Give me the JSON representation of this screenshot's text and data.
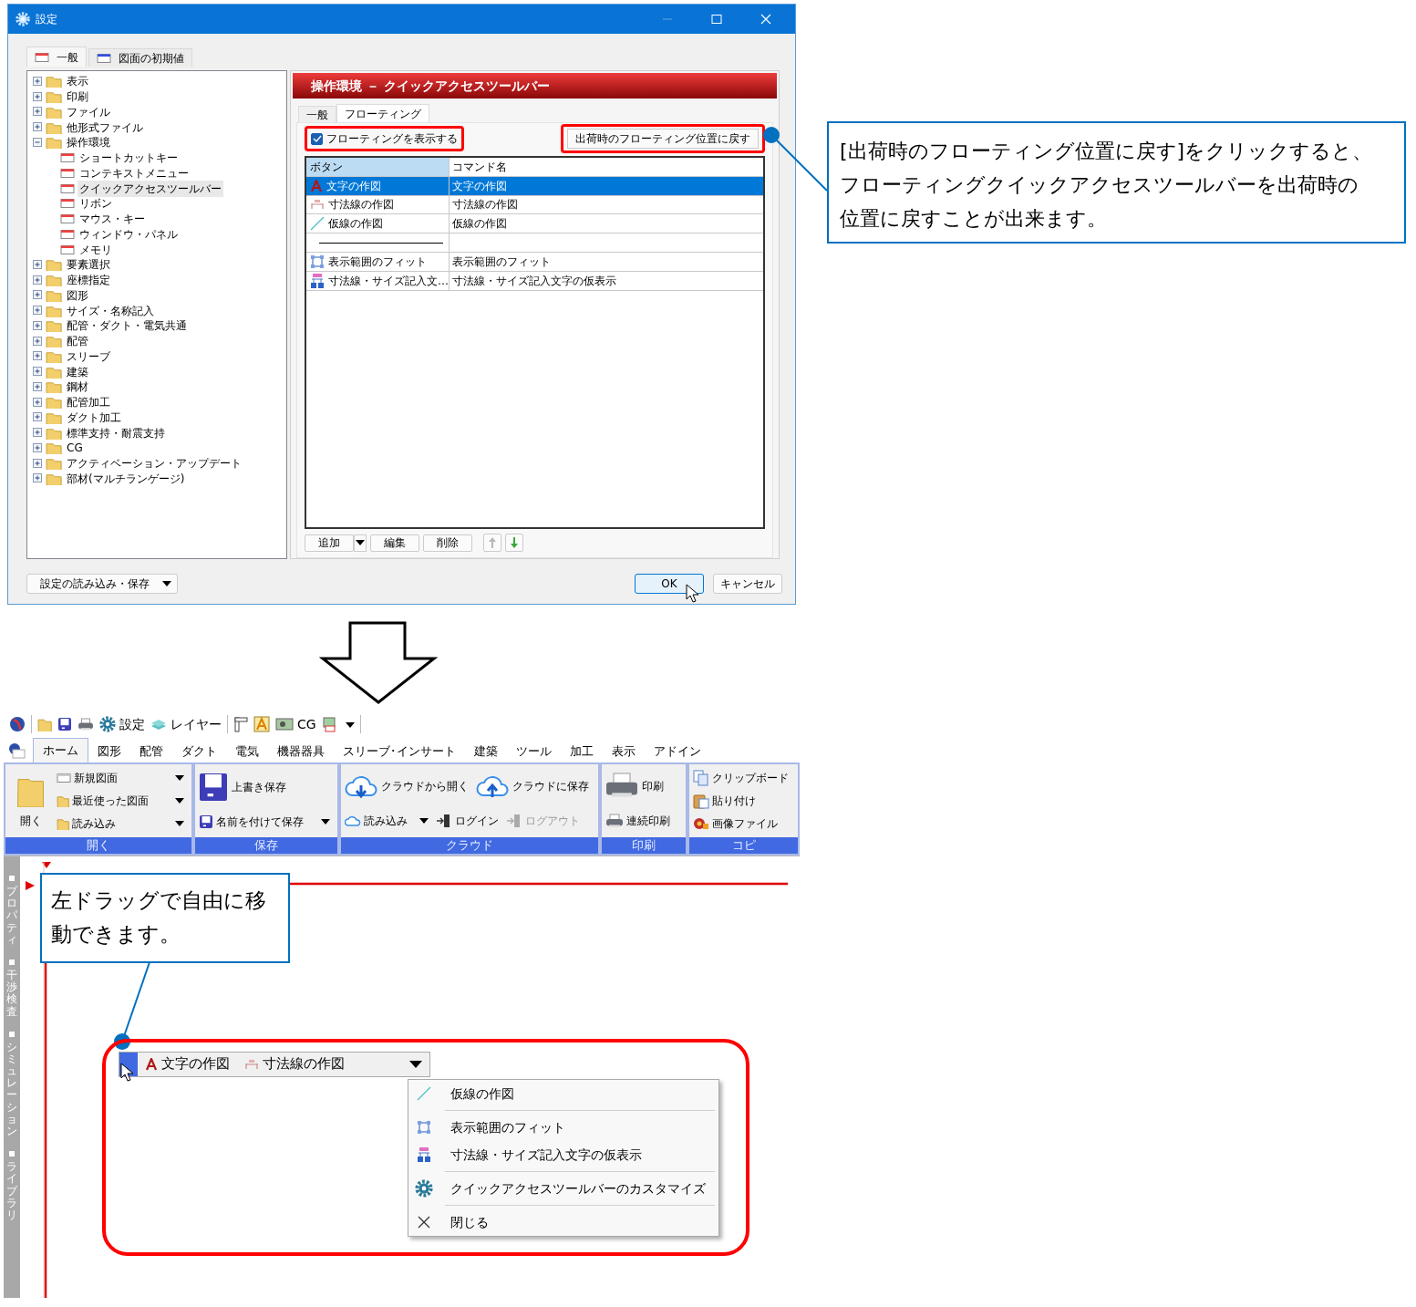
{
  "dialog": {
    "title": "設定",
    "tabs": [
      {
        "label": "一般",
        "selected": true
      },
      {
        "label": "図面の初期値",
        "selected": false
      }
    ],
    "tree": [
      {
        "label": "表示",
        "kind": "folder",
        "expanded": false,
        "selected": false
      },
      {
        "label": "印刷",
        "kind": "folder",
        "expanded": false,
        "selected": false
      },
      {
        "label": "ファイル",
        "kind": "folder",
        "expanded": false,
        "selected": false
      },
      {
        "label": "他形式ファイル",
        "kind": "folder",
        "expanded": false,
        "selected": false
      },
      {
        "label": "操作環境",
        "kind": "folder",
        "expanded": true,
        "selected": false,
        "children": [
          {
            "label": "ショートカットキー",
            "kind": "page",
            "selected": false
          },
          {
            "label": "コンテキストメニュー",
            "kind": "page",
            "selected": false
          },
          {
            "label": "クイックアクセスツールバー",
            "kind": "page",
            "selected": true
          },
          {
            "label": "リボン",
            "kind": "page",
            "selected": false
          },
          {
            "label": "マウス・キー",
            "kind": "page",
            "selected": false
          },
          {
            "label": "ウィンドウ・パネル",
            "kind": "page",
            "selected": false
          },
          {
            "label": "メモリ",
            "kind": "page",
            "selected": false
          }
        ]
      },
      {
        "label": "要素選択",
        "kind": "folder",
        "expanded": false,
        "selected": false
      },
      {
        "label": "座標指定",
        "kind": "folder",
        "expanded": false,
        "selected": false
      },
      {
        "label": "図形",
        "kind": "folder",
        "expanded": false,
        "selected": false
      },
      {
        "label": "サイズ・名称記入",
        "kind": "folder",
        "expanded": false,
        "selected": false
      },
      {
        "label": "配管・ダクト・電気共通",
        "kind": "folder",
        "expanded": false,
        "selected": false
      },
      {
        "label": "配管",
        "kind": "folder",
        "expanded": false,
        "selected": false
      },
      {
        "label": "スリーブ",
        "kind": "folder",
        "expanded": false,
        "selected": false
      },
      {
        "label": "建築",
        "kind": "folder",
        "expanded": false,
        "selected": false
      },
      {
        "label": "鋼材",
        "kind": "folder",
        "expanded": false,
        "selected": false
      },
      {
        "label": "配管加工",
        "kind": "folder",
        "expanded": false,
        "selected": false
      },
      {
        "label": "ダクト加工",
        "kind": "folder",
        "expanded": false,
        "selected": false
      },
      {
        "label": "標準支持・耐震支持",
        "kind": "folder",
        "expanded": false,
        "selected": false
      },
      {
        "label": "CG",
        "kind": "folder",
        "expanded": false,
        "selected": false
      },
      {
        "label": "アクティベーション・アップデート",
        "kind": "folder",
        "expanded": false,
        "selected": false
      },
      {
        "label": "部材(マルチランゲージ)",
        "kind": "folder",
        "expanded": false,
        "selected": false
      }
    ],
    "panel_title": "操作環境 － クイックアクセスツールバー",
    "subtabs": [
      {
        "label": "一般",
        "selected": false
      },
      {
        "label": "フローティング",
        "selected": true
      }
    ],
    "show_floating": {
      "label": "フローティングを表示する",
      "checked": true
    },
    "reset_button": "出荷時のフローティング位置に戻す",
    "table": {
      "columns": [
        "ボタン",
        "コマンド名"
      ],
      "rows": [
        {
          "kind": "text",
          "button": "文字の作図",
          "command": "文字の作図",
          "selected": true
        },
        {
          "kind": "dimension",
          "button": "寸法線の作図",
          "command": "寸法線の作図",
          "selected": false
        },
        {
          "kind": "line",
          "button": "仮線の作図",
          "command": "仮線の作図",
          "selected": false
        },
        {
          "kind": "separator",
          "selected": false
        },
        {
          "kind": "fit",
          "button": "表示範囲のフィット",
          "command": "表示範囲のフィット",
          "selected": false
        },
        {
          "kind": "dimtext",
          "button": "寸法線・サイズ記入文…",
          "command": "寸法線・サイズ記入文字の仮表示",
          "selected": false
        }
      ]
    },
    "list_buttons": [
      "追加",
      "編集",
      "削除"
    ],
    "load_save": "設定の読み込み・保存",
    "buttons": [
      {
        "label": "OK",
        "focused": true
      },
      {
        "label": "キャンセル",
        "focused": false
      }
    ]
  },
  "top_callout": {
    "lines": [
      "[出荷時のフローティング位置に戻す]をクリックすると、",
      "フローティングクイックアクセスツールバーを出荷時の",
      "位置に戻すことが出来ます。"
    ]
  },
  "app": {
    "quick_access": [
      "設定",
      "レイヤー",
      "CG"
    ],
    "ribbon_tabs": [
      {
        "label": "ホーム",
        "selected": true
      },
      {
        "label": "図形",
        "selected": false
      },
      {
        "label": "配管",
        "selected": false
      },
      {
        "label": "ダクト",
        "selected": false
      },
      {
        "label": "電気",
        "selected": false
      },
      {
        "label": "機器器具",
        "selected": false
      },
      {
        "label": "スリーブ･インサート",
        "selected": false
      },
      {
        "label": "建築",
        "selected": false
      },
      {
        "label": "ツール",
        "selected": false
      },
      {
        "label": "加工",
        "selected": false
      },
      {
        "label": "表示",
        "selected": false
      },
      {
        "label": "アドイン",
        "selected": false
      }
    ],
    "groups": [
      {
        "label": "開く",
        "tall": {
          "label": "開く"
        },
        "small_items": [
          {
            "label": "新規図面",
            "dropdown": true,
            "disabled": false
          },
          {
            "label": "最近使った図面",
            "dropdown": true,
            "disabled": false
          },
          {
            "label": "読み込み",
            "dropdown": true,
            "disabled": false
          }
        ]
      },
      {
        "label": "保存",
        "large_items": [
          {
            "label": "上書き保存",
            "dropdown": false,
            "disabled": false
          }
        ],
        "small_items": [
          {
            "label": "名前を付けて保存",
            "dropdown": true,
            "disabled": false
          }
        ]
      },
      {
        "label": "クラウド",
        "large_items": [
          {
            "label": "クラウドから開く",
            "dropdown": false,
            "disabled": false
          },
          {
            "label": "クラウドに保存",
            "dropdown": false,
            "disabled": false
          }
        ],
        "small_items": [
          {
            "label": "読み込み",
            "dropdown": true,
            "disabled": false
          },
          {
            "label": "ログイン",
            "dropdown": false,
            "disabled": false
          },
          {
            "label": "ログアウト",
            "dropdown": false,
            "disabled": true
          }
        ]
      },
      {
        "label": "印刷",
        "large_items": [
          {
            "label": "印刷",
            "dropdown": false,
            "disabled": false
          }
        ],
        "small_items": [
          {
            "label": "連続印刷",
            "dropdown": false,
            "disabled": false
          }
        ]
      },
      {
        "label": "コピ",
        "small_items": [
          {
            "label": "クリップボード",
            "dropdown": false,
            "disabled": false
          },
          {
            "label": "貼り付け",
            "dropdown": false,
            "disabled": false
          },
          {
            "label": "画像ファイル",
            "dropdown": false,
            "disabled": false
          }
        ]
      }
    ],
    "side_tabs": [
      "プロパティ",
      "干渉検査",
      "シミュレーション",
      "ライブラリ"
    ],
    "callout": {
      "lines": [
        "左ドラッグで自由に移",
        "動できます。"
      ]
    },
    "floating_bar": [
      "文字の作図",
      "寸法線の作図"
    ],
    "menu": [
      {
        "kind": "item",
        "label": "仮線の作図"
      },
      {
        "kind": "separator"
      },
      {
        "kind": "item",
        "label": "表示範囲のフィット"
      },
      {
        "kind": "item",
        "label": "寸法線・サイズ記入文字の仮表示"
      },
      {
        "kind": "separator"
      },
      {
        "kind": "item",
        "label": "クイックアクセスツールバーのカスタマイズ"
      },
      {
        "kind": "separator"
      },
      {
        "kind": "item",
        "label": "閉じる"
      }
    ]
  }
}
